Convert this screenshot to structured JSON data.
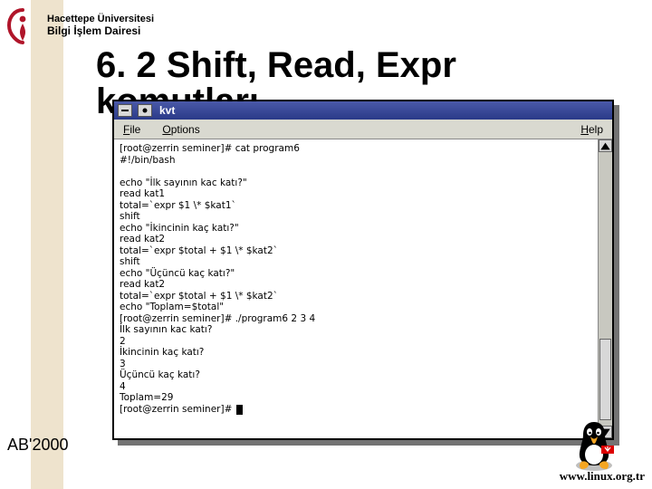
{
  "header": {
    "uni_line1": "Hacettepe Üniversitesi",
    "uni_line2": "Bilgi İşlem Dairesi"
  },
  "slide": {
    "title": "6. 2 Shift, Read, Expr",
    "subtitle": "komutları"
  },
  "terminal": {
    "window_title": "kvt",
    "menu": {
      "file": "File",
      "options": "Options",
      "help": "Help"
    },
    "lines": [
      "[root@zerrin seminer]# cat program6",
      "#!/bin/bash",
      "",
      "echo \"İlk sayının kac katı?\"",
      "read kat1",
      "total=`expr $1 \\* $kat1`",
      "shift",
      "echo \"İkincinin kaç katı?\"",
      "read kat2",
      "total=`expr $total + $1 \\* $kat2`",
      "shift",
      "echo \"Üçüncü kaç katı?\"",
      "read kat2",
      "total=`expr $total + $1 \\* $kat2`",
      "echo \"Toplam=$total\"",
      "[root@zerrin seminer]# ./program6 2 3 4",
      "İlk sayının kac katı?",
      "2",
      "İkincinin kaç katı?",
      "3",
      "Üçüncü kaç katı?",
      "4",
      "Toplam=29",
      "[root@zerrin seminer]# "
    ]
  },
  "footer": {
    "conf": "AB'2000",
    "url": "www.linux.org.tr"
  }
}
